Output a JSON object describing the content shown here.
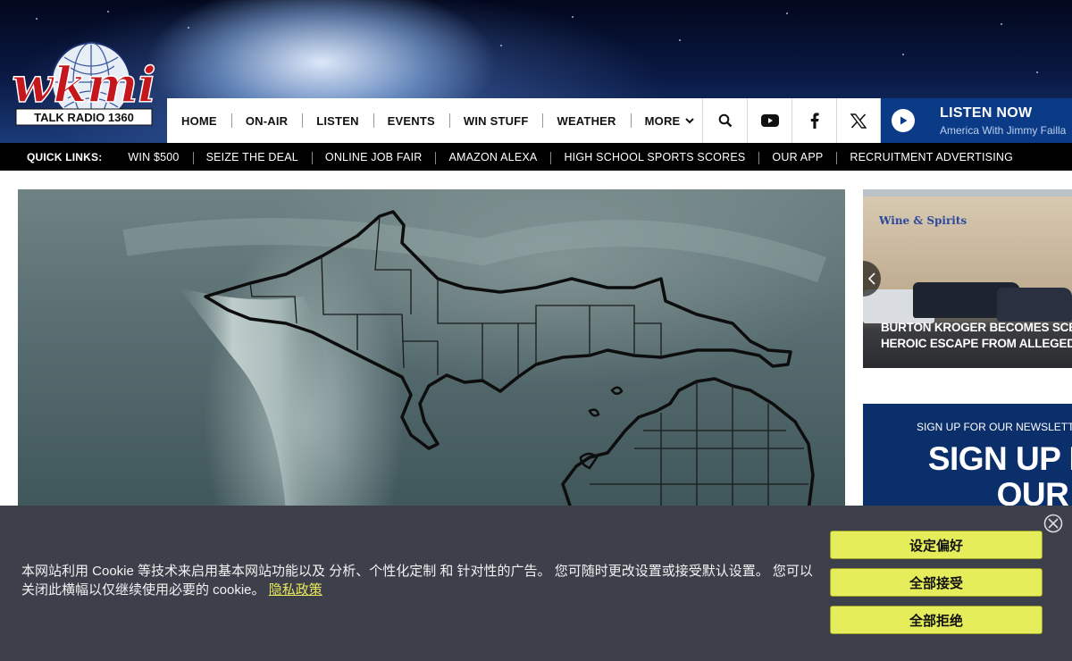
{
  "logo": {
    "text": "wkmi",
    "subtitle": "TALK RADIO 1360"
  },
  "nav": {
    "links": [
      "HOME",
      "ON-AIR",
      "LISTEN",
      "EVENTS",
      "WIN STUFF",
      "WEATHER"
    ],
    "more_label": "MORE",
    "icons": [
      "search-icon",
      "youtube-icon",
      "facebook-icon",
      "x-icon"
    ]
  },
  "listen_now": {
    "title": "LISTEN NOW",
    "subtitle": "America With Jimmy Failla"
  },
  "quick_links": {
    "label": "QUICK LINKS:",
    "items": [
      "WIN $500",
      "SEIZE THE DEAL",
      "ONLINE JOB FAIR",
      "AMAZON ALEXA",
      "HIGH SCHOOL SPORTS SCORES",
      "OUR APP",
      "RECRUITMENT ADVERTISING"
    ]
  },
  "side_story": {
    "sign": "Wine & Spirits",
    "caption_line1": "BURTON KROGER BECOMES SCENE",
    "caption_line2": "HEROIC ESCAPE FROM ALLEGED..."
  },
  "newsletter": {
    "small": "SIGN UP FOR OUR NEWSLETTER",
    "big_line1": "SIGN UP FOR",
    "big_line2": "OUR"
  },
  "cookie": {
    "message": "本网站利用 Cookie 等技术来启用基本网站功能以及 分析、个性化定制 和 针对性的广告。 您可随时更改设置或接受默认设置。 您可以关闭此横幅以仅继续使用必要的 cookie。",
    "policy_link": "隐私政策",
    "buttons": [
      "设定偏好",
      "全部接受",
      "全部拒绝"
    ]
  },
  "colors": {
    "nav_blue": "#0b3a86",
    "cookie_bg": "#3d3f4b",
    "cookie_button": "#e6ed5a",
    "logo_red": "#c4161c"
  }
}
